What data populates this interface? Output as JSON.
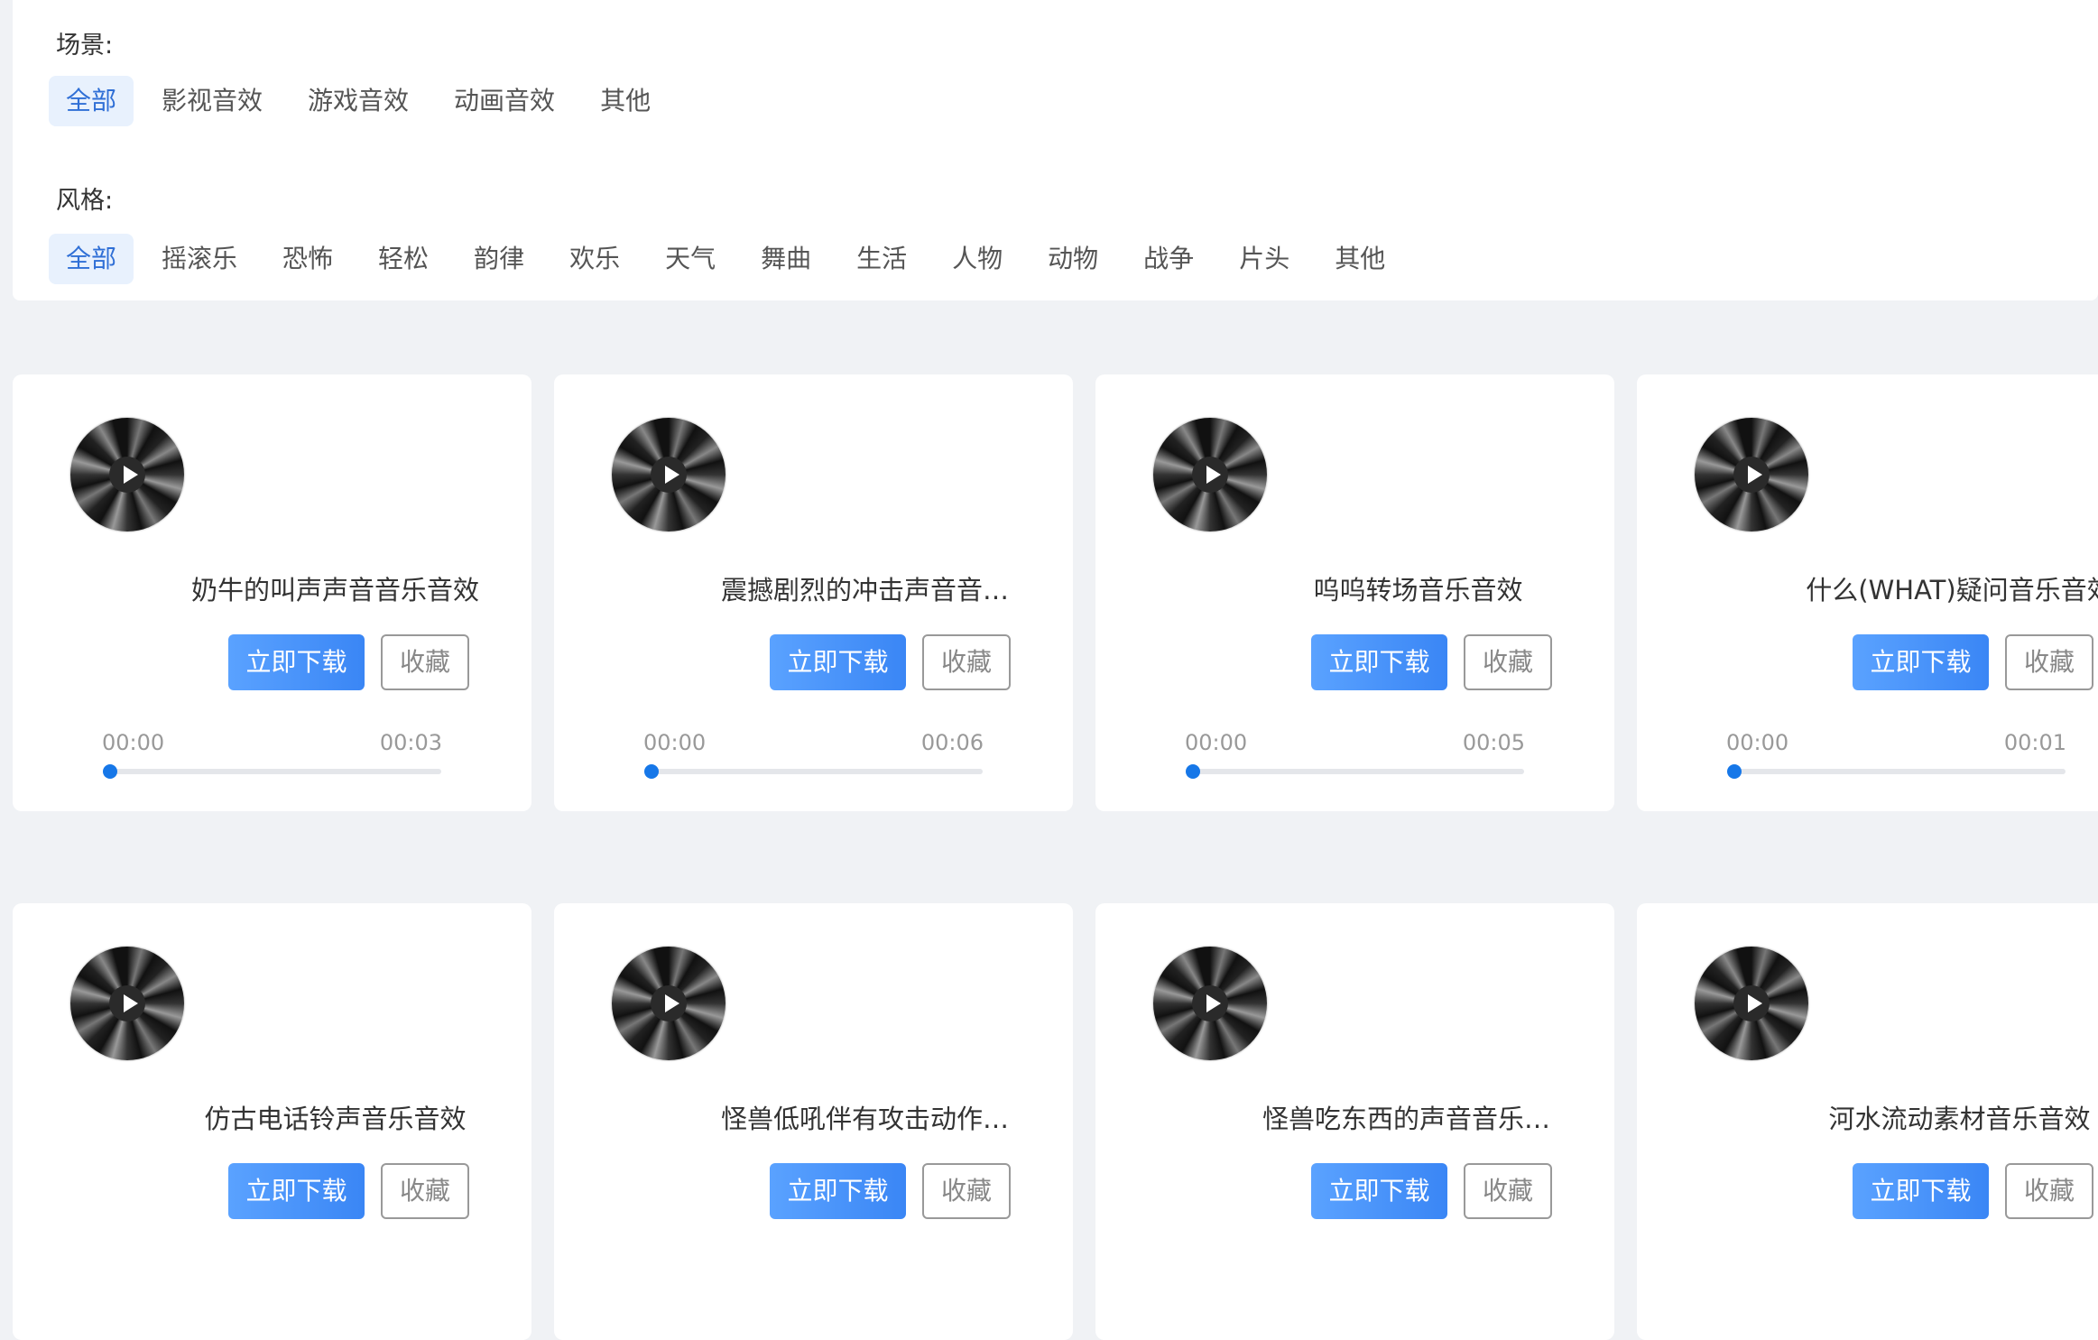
{
  "filters": {
    "scene": {
      "label": "场景:",
      "tags": [
        "全部",
        "影视音效",
        "游戏音效",
        "动画音效",
        "其他"
      ],
      "active": "全部"
    },
    "style": {
      "label": "风格:",
      "tags": [
        "全部",
        "摇滚乐",
        "恐怖",
        "轻松",
        "韵律",
        "欢乐",
        "天气",
        "舞曲",
        "生活",
        "人物",
        "动物",
        "战争",
        "片头",
        "其他"
      ],
      "active": "全部"
    }
  },
  "colors": {
    "accent": "#3a86f5",
    "active_tag_bg": "#e8f1fd",
    "background": "#f0f2f5"
  },
  "buttons": {
    "download": "立即下载",
    "favorite": "收藏"
  },
  "cards": [
    {
      "title": "奶牛的叫声声音音乐音效",
      "current": "00:00",
      "duration": "00:03",
      "progress": 0
    },
    {
      "title": "震撼剧烈的冲击声音音乐音效",
      "current": "00:00",
      "duration": "00:06",
      "progress": 0
    },
    {
      "title": "呜呜转场音乐音效",
      "current": "00:00",
      "duration": "00:05",
      "progress": 0
    },
    {
      "title": "什么(WHAT)疑问音乐音效",
      "current": "00:00",
      "duration": "00:01",
      "progress": 0
    },
    {
      "title": "仿古电话铃声音乐音效"
    },
    {
      "title": "怪兽低吼伴有攻击动作音乐音效"
    },
    {
      "title": "怪兽吃东西的声音音乐音效"
    },
    {
      "title": "河水流动素材音乐音效"
    }
  ]
}
